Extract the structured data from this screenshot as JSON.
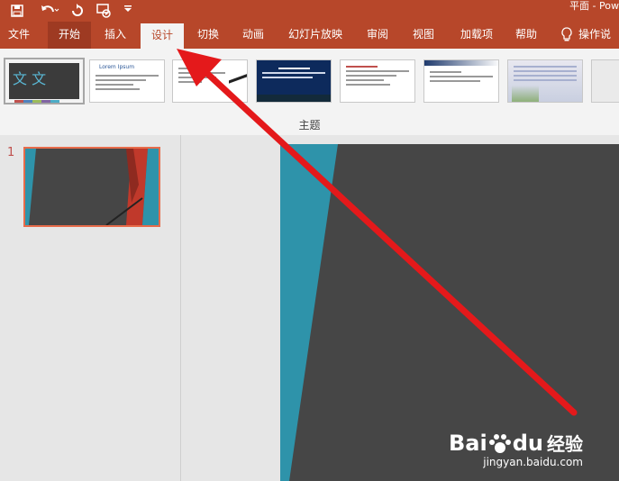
{
  "window": {
    "title": "平面 - Pow"
  },
  "qat": {
    "save_icon": "save-icon",
    "undo_icon": "undo-icon",
    "repeat_icon": "repeat-icon",
    "present_icon": "present-from-beginning-icon",
    "customize_icon": "customize-qat-icon"
  },
  "tabs": [
    {
      "label": "文件"
    },
    {
      "label": "开始"
    },
    {
      "label": "插入"
    },
    {
      "label": "设计"
    },
    {
      "label": "切换"
    },
    {
      "label": "动画"
    },
    {
      "label": "幻灯片放映"
    },
    {
      "label": "审阅"
    },
    {
      "label": "视图"
    },
    {
      "label": "加载项"
    },
    {
      "label": "帮助"
    }
  ],
  "tell_me": {
    "label": "操作说"
  },
  "ribbon": {
    "group_label": "主题",
    "theme_preview_text": {
      "office_theme": "文  文",
      "sample_heading": "Lorem Ipsum"
    }
  },
  "slides": {
    "current_number": "1"
  },
  "colors": {
    "brand": "#b7472a",
    "accent_teal": "#2e93aa",
    "slide_bg": "#464646",
    "accent_red": "#c0392b",
    "selection": "#e76b4a",
    "arrow": "#e4191b"
  },
  "watermark": {
    "brand": "Bai",
    "paw": "du",
    "site_name": "经验",
    "url": "jingyan.baidu.com"
  }
}
